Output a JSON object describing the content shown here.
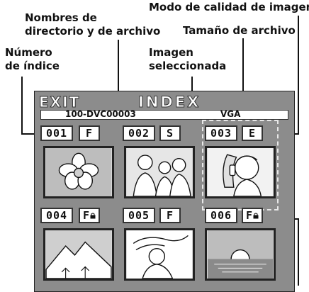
{
  "callouts": {
    "quality_mode": "Modo de calidad de imagen",
    "names_line1": "Nombres de",
    "names_line2": "directorio y de archivo",
    "file_size": "Tamaño de archivo",
    "index_line1": "Número",
    "index_line2": "de índice",
    "selected_line1": "Imagen",
    "selected_line2": "seleccionada"
  },
  "screen": {
    "exit_label": "EXIT",
    "title": "INDEX",
    "dir_file_name": "100-DVC00003",
    "file_size_value": "VGA"
  },
  "thumbnails": [
    {
      "index": "001",
      "quality": "F",
      "icon": "flower-icon"
    },
    {
      "index": "002",
      "quality": "S",
      "icon": "people-icon"
    },
    {
      "index": "003",
      "quality": "E",
      "icon": "girl-phone-icon",
      "selected": true
    },
    {
      "index": "004",
      "quality": "F",
      "icon": "mountain-icon",
      "protected": true
    },
    {
      "index": "005",
      "quality": "F",
      "icon": "woman-wind-icon"
    },
    {
      "index": "006",
      "quality": "F",
      "icon": "sunset-icon",
      "protected": true
    }
  ]
}
